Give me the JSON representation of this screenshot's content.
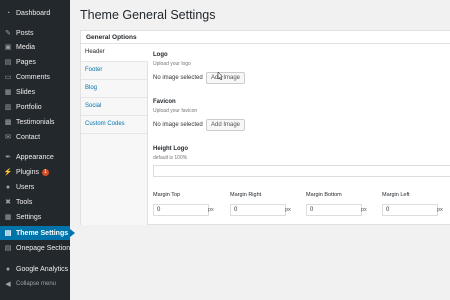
{
  "sidebar": {
    "items": [
      {
        "label": "Dashboard",
        "icon": "dashboard-icon",
        "glyph": "◔"
      },
      {
        "label": "Posts",
        "icon": "pin-icon",
        "glyph": "✎"
      },
      {
        "label": "Media",
        "icon": "media-icon",
        "glyph": "▣"
      },
      {
        "label": "Pages",
        "icon": "pages-icon",
        "glyph": "▤"
      },
      {
        "label": "Comments",
        "icon": "comments-icon",
        "glyph": "▭"
      },
      {
        "label": "Slides",
        "icon": "slides-icon",
        "glyph": "▦"
      },
      {
        "label": "Portfolio",
        "icon": "portfolio-icon",
        "glyph": "▥"
      },
      {
        "label": "Testimonials",
        "icon": "testimonials-icon",
        "glyph": "▩"
      },
      {
        "label": "Contact",
        "icon": "contact-icon",
        "glyph": "✉"
      },
      {
        "label": "Appearance",
        "icon": "appearance-icon",
        "glyph": "✒"
      },
      {
        "label": "Plugins",
        "icon": "plugins-icon",
        "glyph": "⚡",
        "badge": "1"
      },
      {
        "label": "Users",
        "icon": "users-icon",
        "glyph": "●"
      },
      {
        "label": "Tools",
        "icon": "tools-icon",
        "glyph": "✖"
      },
      {
        "label": "Settings",
        "icon": "settings-icon",
        "glyph": "▦"
      },
      {
        "label": "Theme Settings",
        "icon": "theme-settings-icon",
        "glyph": "▤",
        "active": true
      },
      {
        "label": "Onepage Sections",
        "icon": "onepage-sections-icon",
        "glyph": "▤"
      },
      {
        "label": "Google Analytics",
        "icon": "analytics-icon",
        "glyph": "●"
      },
      {
        "label": "Collapse menu",
        "icon": "collapse-icon",
        "glyph": "◀"
      }
    ]
  },
  "page": {
    "title": "Theme General Settings"
  },
  "panel": {
    "heading": "General Options",
    "tabs": [
      {
        "label": "Header",
        "active": true
      },
      {
        "label": "Footer"
      },
      {
        "label": "Blog"
      },
      {
        "label": "Social"
      },
      {
        "label": "Custom Codes"
      }
    ]
  },
  "fields": {
    "logo": {
      "label": "Logo",
      "desc": "Upload your logo",
      "status": "No image selected",
      "button": "Add Image"
    },
    "favicon": {
      "label": "Favicon",
      "desc": "Upload your favicon",
      "status": "No image selected",
      "button": "Add Image"
    },
    "height_logo": {
      "label": "Height Logo",
      "desc": "default is 100%"
    },
    "margins": [
      {
        "label": "Margin Top",
        "value": "0",
        "unit": "px"
      },
      {
        "label": "Margin Right",
        "value": "0",
        "unit": "px"
      },
      {
        "label": "Margin Bottom",
        "value": "0",
        "unit": "px"
      },
      {
        "label": "Margin Left",
        "value": "0",
        "unit": "px"
      }
    ]
  },
  "colors": {
    "sidebar_bg": "#23282d",
    "accent": "#0073aa",
    "badge": "#d54e21"
  }
}
